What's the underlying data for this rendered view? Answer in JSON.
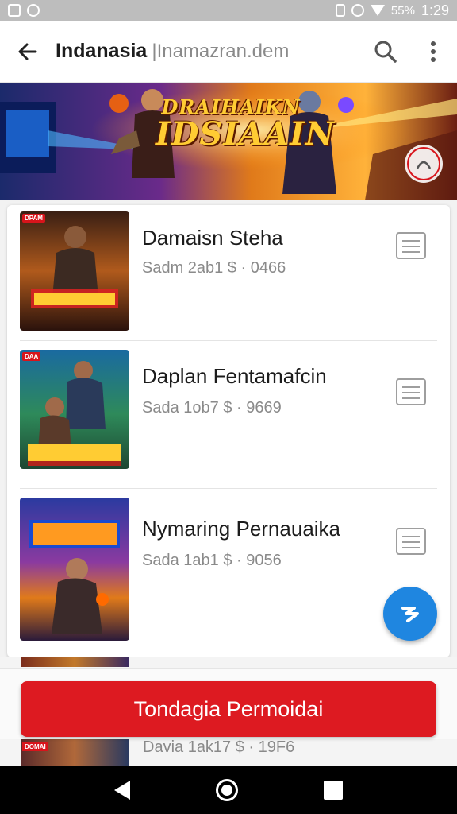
{
  "status_bar": {
    "battery": "55%",
    "time": "1:29"
  },
  "app_bar": {
    "title": "Indanasia",
    "subtitle": "|Inamazran.dem"
  },
  "banner": {
    "title_line1": "DRAIHAIKN",
    "title_line2": "IDSIAAIN"
  },
  "items": [
    {
      "title": "Damaisn Steha",
      "meta": "Sadm 2ab1  $ · 0466",
      "tag": "DPAM"
    },
    {
      "title": "Daplan Fentamafcin",
      "meta": "Sada 1ob7  $ · 9669",
      "tag": "DAA"
    },
    {
      "title": "Nymaring Pernauaika",
      "meta": "Sada 1ab1  $ · 9056",
      "tag": ""
    }
  ],
  "peek_item": {
    "meta": "Davia 1ak17  $ · 19F6",
    "tag": "DOMAI"
  },
  "cta": {
    "label": "Tondagia Permoidai"
  },
  "colors": {
    "accent": "#dd1a21",
    "fab": "#1f86e0"
  }
}
